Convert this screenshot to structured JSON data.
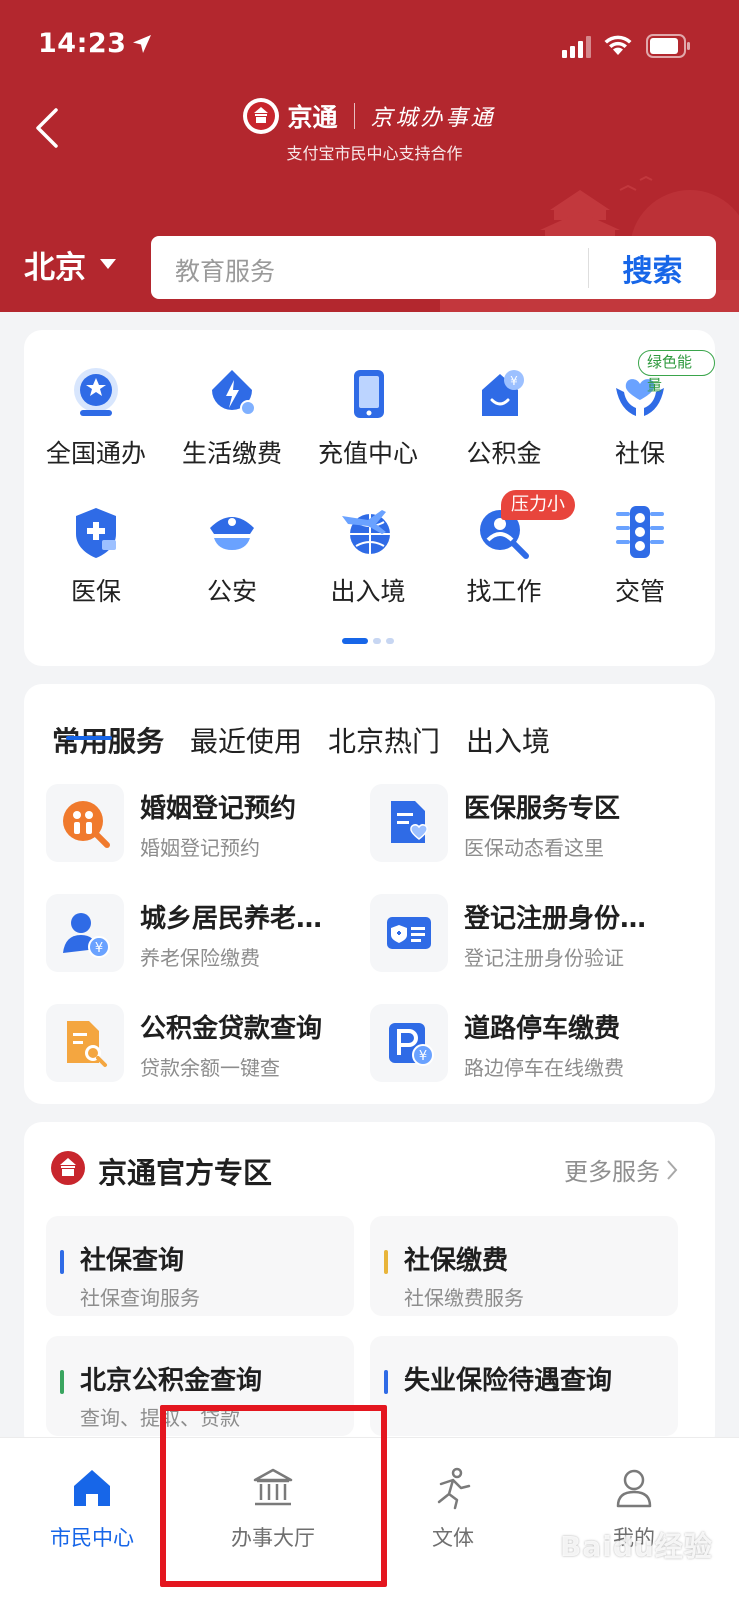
{
  "status_bar": {
    "time": "14:23"
  },
  "header": {
    "brand_name": "京通",
    "brand_slogan": "京城办事通",
    "brand_sub": "支付宝市民中心支持合作",
    "logo_text": "京通",
    "city": "北京",
    "search_placeholder": "教育服务",
    "search_button": "搜索"
  },
  "grid": {
    "items": [
      {
        "label": "全国通办",
        "icon": "national-service-icon"
      },
      {
        "label": "生活缴费",
        "icon": "utility-payment-icon"
      },
      {
        "label": "充值中心",
        "icon": "recharge-icon"
      },
      {
        "label": "公积金",
        "icon": "housing-fund-icon"
      },
      {
        "label": "社保",
        "icon": "social-security-icon"
      },
      {
        "label": "医保",
        "icon": "medical-insurance-icon"
      },
      {
        "label": "公安",
        "icon": "police-icon"
      },
      {
        "label": "出入境",
        "icon": "immigration-icon"
      },
      {
        "label": "找工作",
        "icon": "job-search-icon"
      },
      {
        "label": "交管",
        "icon": "traffic-light-icon"
      }
    ],
    "green_badge": "绿色能量",
    "red_badge": "压力小"
  },
  "services": {
    "tabs": [
      "常用服务",
      "最近使用",
      "北京热门",
      "出入境"
    ],
    "items": [
      {
        "title": "婚姻登记预约",
        "sub": "婚姻登记预约",
        "icon": "marriage-icon"
      },
      {
        "title": "医保服务专区",
        "sub": "医保动态看这里",
        "icon": "medical-doc-icon"
      },
      {
        "title": "城乡居民养老…",
        "sub": "养老保险缴费",
        "icon": "pension-icon"
      },
      {
        "title": "登记注册身份…",
        "sub": "登记注册身份验证",
        "icon": "id-card-icon"
      },
      {
        "title": "公积金贷款查询",
        "sub": "贷款余额一键查",
        "icon": "loan-query-icon"
      },
      {
        "title": "道路停车缴费",
        "sub": "路边停车在线缴费",
        "icon": "parking-icon"
      }
    ]
  },
  "official": {
    "title": "京通官方专区",
    "more": "更多服务",
    "tiles": [
      {
        "title": "社保查询",
        "sub": "社保查询服务",
        "bar_color": "#2f6be6"
      },
      {
        "title": "社保缴费",
        "sub": "社保缴费服务",
        "bar_color": "#e8b43a"
      },
      {
        "title": "北京公积金查询",
        "sub": "查询、提取、贷款",
        "bar_color": "#3aa560"
      },
      {
        "title": "失业保险待遇查询",
        "sub": "",
        "bar_color": "#2f6be6"
      }
    ]
  },
  "bottom_nav": {
    "items": [
      {
        "label": "市民中心",
        "icon": "home-icon",
        "active": true
      },
      {
        "label": "办事大厅",
        "icon": "bank-hall-icon",
        "active": false
      },
      {
        "label": "文体",
        "icon": "running-icon",
        "active": false
      },
      {
        "label": "我的",
        "icon": "user-icon",
        "active": false
      }
    ]
  },
  "watermark": "Baidu经验",
  "colors": {
    "header_red": "#b3272e",
    "accent_blue": "#1766e8",
    "highlight_red": "#e4161f"
  }
}
